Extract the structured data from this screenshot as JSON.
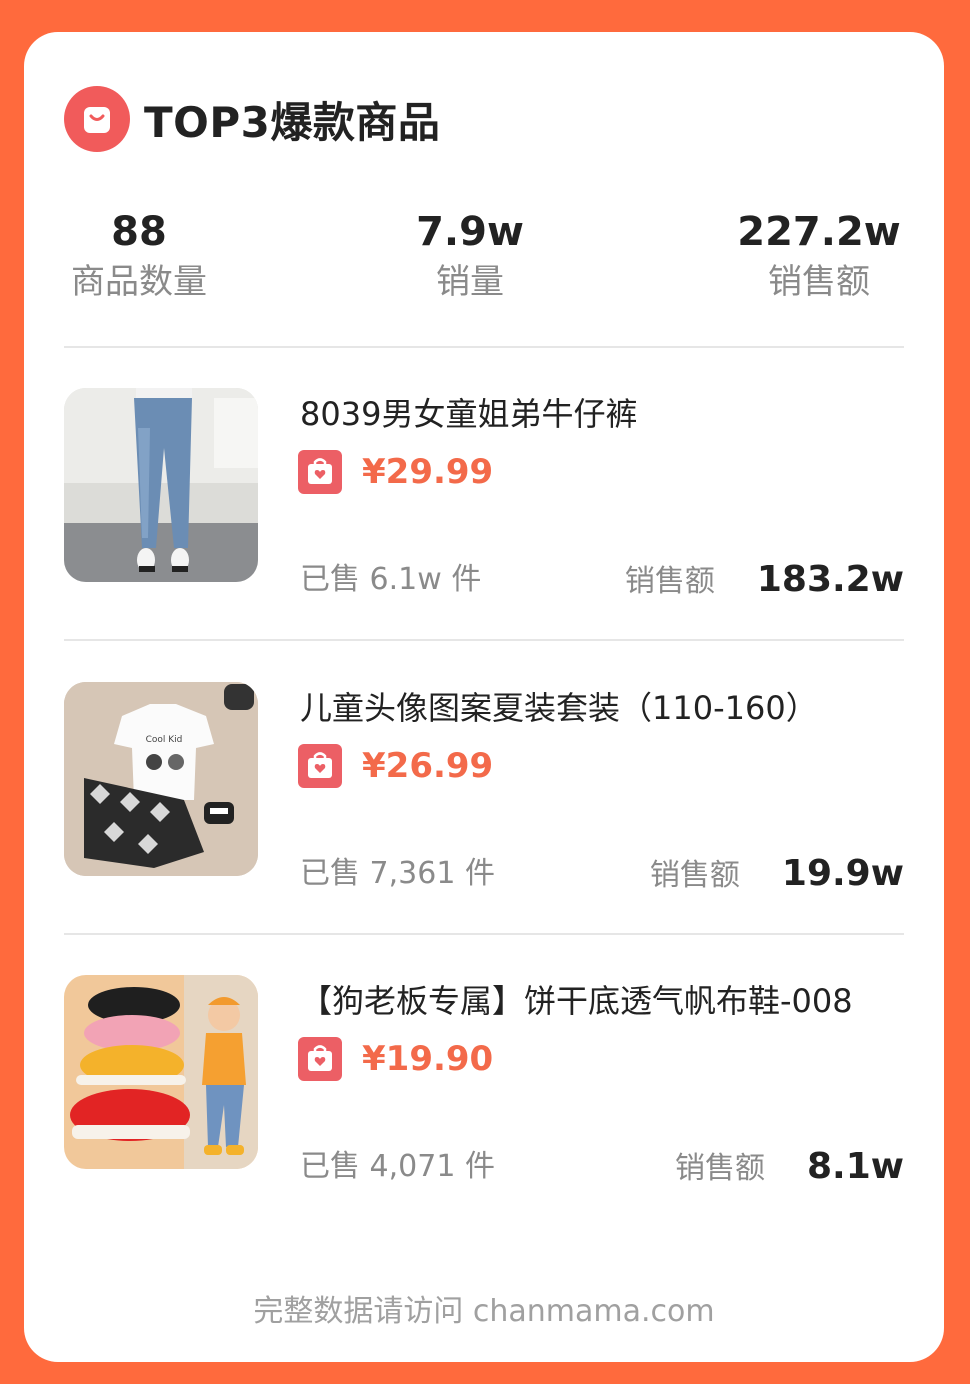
{
  "header": {
    "title": "TOP3爆款商品",
    "icon": "shopping-bag-icon"
  },
  "summary": [
    {
      "value": "88",
      "label": "商品数量"
    },
    {
      "value": "7.9w",
      "label": "销量"
    },
    {
      "value": "227.2w",
      "label": "销售额"
    }
  ],
  "products": [
    {
      "name": "8039男女童姐弟牛仔裤",
      "price": "¥29.99",
      "sold": "已售 6.1w 件",
      "gmv_label": "销售额",
      "gmv": "183.2w",
      "image": "jeans-photo"
    },
    {
      "name": "儿童头像图案夏装套装（110-160）",
      "price": "¥26.99",
      "sold": "已售 7,361 件",
      "gmv_label": "销售额",
      "gmv": "19.9w",
      "image": "kids-tshirt-set-photo"
    },
    {
      "name": "【狗老板专属】饼干底透气帆布鞋-008",
      "price": "¥19.90",
      "sold": "已售 4,071 件",
      "gmv_label": "销售额",
      "gmv": "8.1w",
      "image": "canvas-shoes-photo"
    }
  ],
  "footer": {
    "text": "完整数据请访问 chanmama.com"
  },
  "colors": {
    "brand": "#ff6a3d",
    "accent": "#f15b5b",
    "price": "#f36a4a"
  }
}
